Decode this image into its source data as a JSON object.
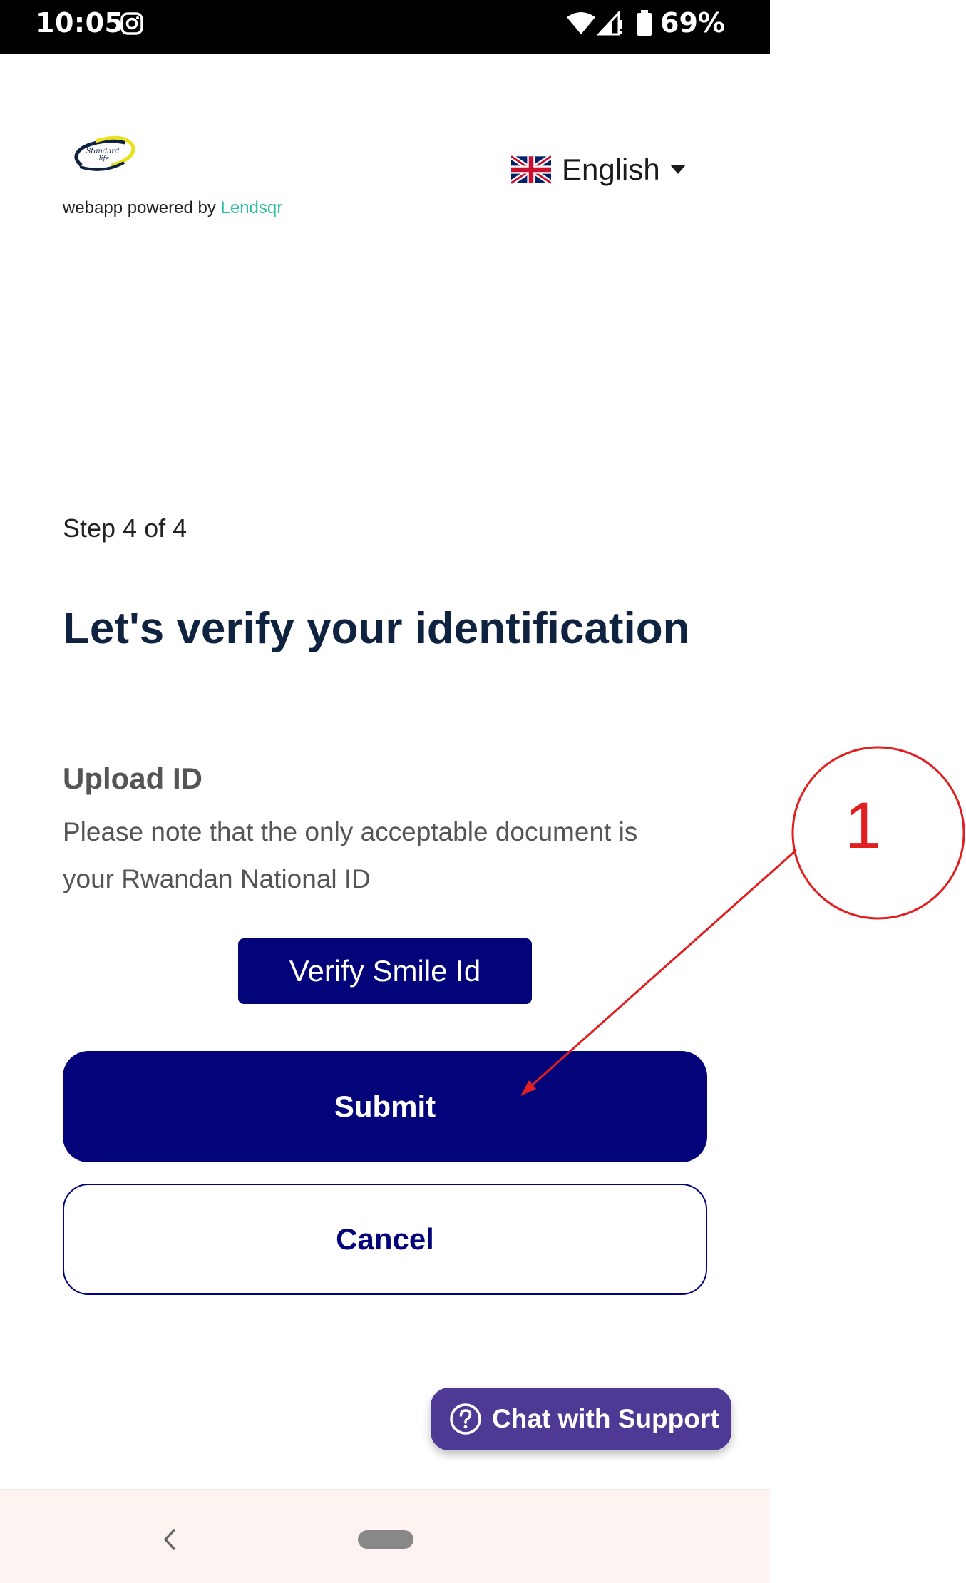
{
  "status_bar": {
    "time": "10:05",
    "battery": "69%",
    "icons": [
      "instagram-icon",
      "wifi-icon",
      "signal-icon",
      "battery-icon"
    ]
  },
  "header": {
    "logo_name": "standard-life-logo",
    "powered_by": "webapp powered by",
    "brand": "Lendsqr",
    "language": "English"
  },
  "form": {
    "step": "Step 4 of 4",
    "title": "Let's verify your identification",
    "upload_title": "Upload ID",
    "upload_description": "Please note that the only acceptable document is your Rwandan National ID",
    "verify_button": "Verify Smile Id",
    "submit_button": "Submit",
    "cancel_button": "Cancel"
  },
  "support": {
    "chat_label": "Chat with Support"
  },
  "annotation": {
    "label": "1"
  },
  "colors": {
    "primary": "#03047a",
    "title": "#0f2240",
    "brand": "#2bbf9e",
    "chat": "#4e3a94",
    "annotation": "#e02020"
  }
}
